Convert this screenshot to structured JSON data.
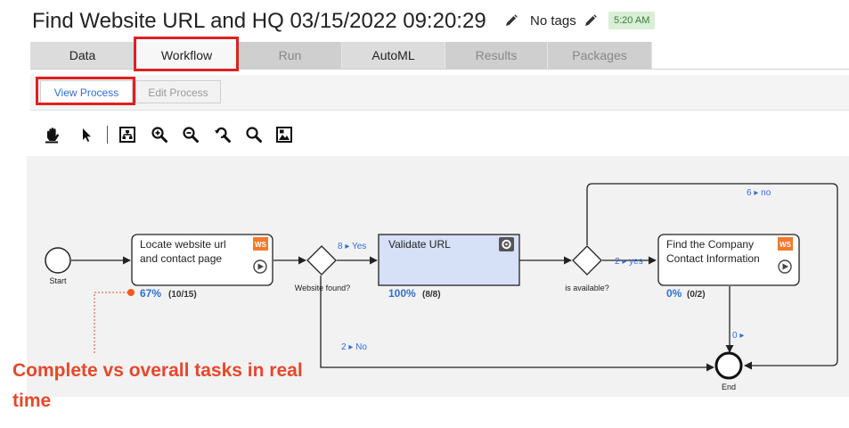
{
  "header": {
    "title": "Find Website URL and HQ 03/15/2022 09:20:29",
    "tags": "No tags",
    "time_badge": "5:20 AM",
    "edit_icon": "pencil-icon"
  },
  "tabs": [
    {
      "label": "Data",
      "enabled": true
    },
    {
      "label": "Workflow",
      "enabled": true,
      "active": true
    },
    {
      "label": "Run",
      "enabled": false
    },
    {
      "label": "AutoML",
      "enabled": true
    },
    {
      "label": "Results",
      "enabled": false
    },
    {
      "label": "Packages",
      "enabled": false
    }
  ],
  "subtabs": [
    {
      "label": "View Process",
      "active": true
    },
    {
      "label": "Edit Process",
      "active": false
    }
  ],
  "toolbar": [
    "hand-pan-icon",
    "pointer-icon",
    "fit-diagram-icon",
    "zoom-in-icon",
    "zoom-out-icon",
    "zoom-reset-icon",
    "zoom-icon",
    "screenshot-icon"
  ],
  "flow": {
    "start_label": "Start",
    "end_label": "End",
    "tasks": [
      {
        "title_1": "Locate website url",
        "title_2": "and contact page",
        "badge": "WS",
        "progress_pct": "67%",
        "progress_count": "(10/15)"
      },
      {
        "title_1": "Validate URL",
        "title_2": "",
        "badge": "",
        "progress_pct": "100%",
        "progress_count": "(8/8)"
      },
      {
        "title_1": "Find the Company",
        "title_2": "Contact Information",
        "badge": "WS",
        "progress_pct": "0%",
        "progress_count": "(0/2)"
      }
    ],
    "gateways": [
      {
        "label": "Website found?",
        "yes_label": "8 ▸ Yes",
        "no_label": "2 ▸ No"
      },
      {
        "label": "is available?",
        "yes_label": "2 ▸ yes",
        "no_label": "6 ▸ no"
      }
    ],
    "end_in_label": "0 ▸",
    "colors": {
      "accent": "#2f6fd6",
      "validate_fill": "#d6e0f7",
      "badge_orange": "#f47a2a"
    }
  },
  "annotation": {
    "caption": "Complete vs overall tasks in real time",
    "color": "#e5482b"
  }
}
